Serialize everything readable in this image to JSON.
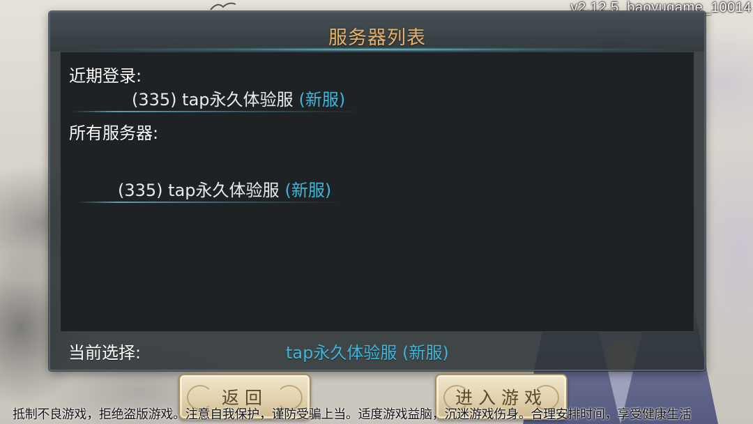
{
  "version": "v2.12.5_baoyugame_10014",
  "dialog": {
    "title": "服务器列表",
    "recent_label": "近期登录:",
    "recent_server": {
      "name": "(335) tap永久体验服",
      "tag": "(新服)"
    },
    "all_label": "所有服务器:",
    "all_servers": [
      {
        "name": "(335) tap永久体验服",
        "tag": "(新服)"
      }
    ],
    "current_label": "当前选择:",
    "current_value": "tap永久体验服 (新服)"
  },
  "buttons": {
    "back": "返回",
    "enter": "进入游戏"
  },
  "notice": "抵制不良游戏，拒绝盗版游戏。注意自我保护，谨防受骗上当。适度游戏益脑，沉迷游戏伤身。合理安排时间，享受健康生活",
  "colors": {
    "accent_title": "#e6b26a",
    "server_tag": "#3fb6d8",
    "panel_bg": "#1f2225"
  }
}
